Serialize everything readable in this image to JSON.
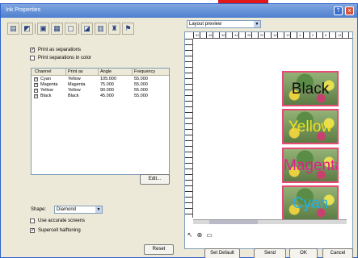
{
  "window": {
    "title": "Ink Properties",
    "accent_color": "#e01818",
    "titlebar_buttons": [
      "?",
      "x"
    ]
  },
  "toolbar": {
    "icons": [
      "ink-icon",
      "stamp-icon",
      "layer-icon",
      "grid-icon",
      "frame-icon",
      "print-icon",
      "color-bars-icon",
      "flag-icon",
      "hat-icon"
    ]
  },
  "options": {
    "print_separations": {
      "label": "Print as separations",
      "checked": true
    },
    "print_separations_color": {
      "label": "Print separations in color",
      "checked": false
    }
  },
  "table": {
    "headers": [
      "Channel",
      "Print as",
      "Angle",
      "Frequency"
    ],
    "rows": [
      {
        "checked": true,
        "channel": "Cyan",
        "print_as": "Yellow",
        "angle": "105.000",
        "frequency": "55.000"
      },
      {
        "checked": true,
        "channel": "Magenta",
        "print_as": "Magenta",
        "angle": "75.000",
        "frequency": "55.000"
      },
      {
        "checked": true,
        "channel": "Yellow",
        "print_as": "Yellow",
        "angle": "90.000",
        "frequency": "55.000"
      },
      {
        "checked": true,
        "channel": "Black",
        "print_as": "Black",
        "angle": "45.000",
        "frequency": "55.000"
      }
    ]
  },
  "edit_button": "Edit...",
  "shape": {
    "label": "Shape:",
    "value": "Diamond"
  },
  "use_accurate_screens": {
    "label": "Use accurate screens",
    "checked": false
  },
  "supercell": {
    "label": "Supercell halftoning",
    "checked": true
  },
  "reset_button": "Reset",
  "preview": {
    "mode": "Layout preview",
    "ruler_numbers": [
      "52",
      "46",
      "40",
      "34",
      "28",
      "22",
      "16",
      "10",
      "4",
      "2",
      "8",
      "14"
    ],
    "separations": [
      {
        "label": "Black",
        "color": "#111111"
      },
      {
        "label": "Yellow",
        "color": "#f0e020"
      },
      {
        "label": "Magenta",
        "color": "#e0208c"
      },
      {
        "label": "Cyan",
        "color": "#20b0e8"
      }
    ]
  },
  "bottom_buttons": {
    "set_default": "Set Default",
    "send": "Send",
    "ok": "OK",
    "cancel": "Cancel"
  }
}
